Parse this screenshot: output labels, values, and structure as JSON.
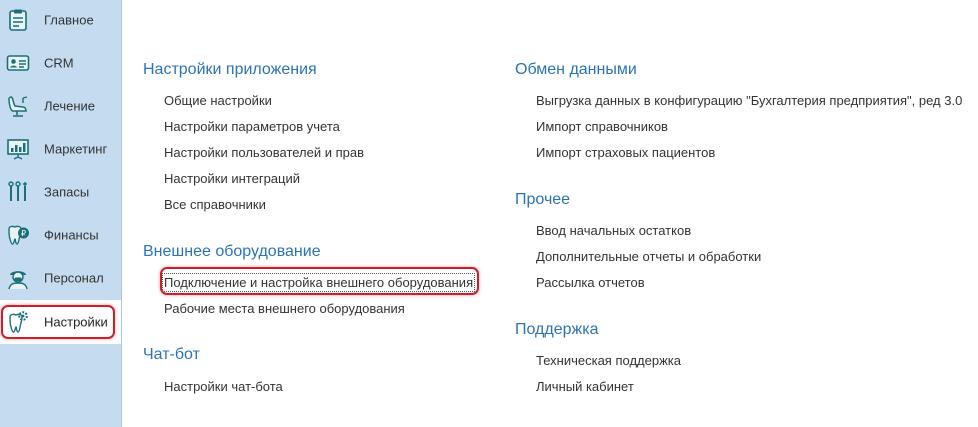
{
  "sidebar": {
    "items": [
      {
        "label": "Главное",
        "icon": "clipboard-icon"
      },
      {
        "label": "CRM",
        "icon": "contact-card-icon"
      },
      {
        "label": "Лечение",
        "icon": "dental-chair-icon"
      },
      {
        "label": "Маркетинг",
        "icon": "presentation-chart-icon"
      },
      {
        "label": "Запасы",
        "icon": "dental-tools-icon"
      },
      {
        "label": "Финансы",
        "icon": "tooth-coin-icon"
      },
      {
        "label": "Персонал",
        "icon": "doctor-icon"
      },
      {
        "label": "Настройки",
        "icon": "tooth-gear-icon"
      }
    ],
    "active": "Настройки"
  },
  "sections": {
    "app_settings": {
      "title": "Настройки приложения",
      "links": [
        "Общие настройки",
        "Настройки параметров учета",
        "Настройки пользователей и прав",
        "Настройки интеграций",
        "Все справочники"
      ]
    },
    "external_equipment": {
      "title": "Внешнее оборудование",
      "links": [
        "Подключение и настройка внешнего оборудования",
        "Рабочие места внешнего оборудования"
      ]
    },
    "chatbot": {
      "title": "Чат-бот",
      "links": [
        "Настройки чат-бота"
      ]
    },
    "data_exchange": {
      "title": "Обмен данными",
      "links": [
        "Выгрузка данных в конфигурацию \"Бухгалтерия предприятия\", ред 3.0",
        "Импорт справочников",
        "Импорт страховых пациентов"
      ]
    },
    "other": {
      "title": "Прочее",
      "links": [
        "Ввод начальных остатков",
        "Дополнительные отчеты и обработки",
        "Рассылка отчетов"
      ]
    },
    "support": {
      "title": "Поддержка",
      "links": [
        "Техническая поддержка",
        "Личный кабинет"
      ]
    }
  },
  "colors": {
    "sidebar_bg": "#c5dcf0",
    "section_title": "#2b73b8",
    "highlight": "#c8212c",
    "icon_teal": "#1a6f7a"
  }
}
